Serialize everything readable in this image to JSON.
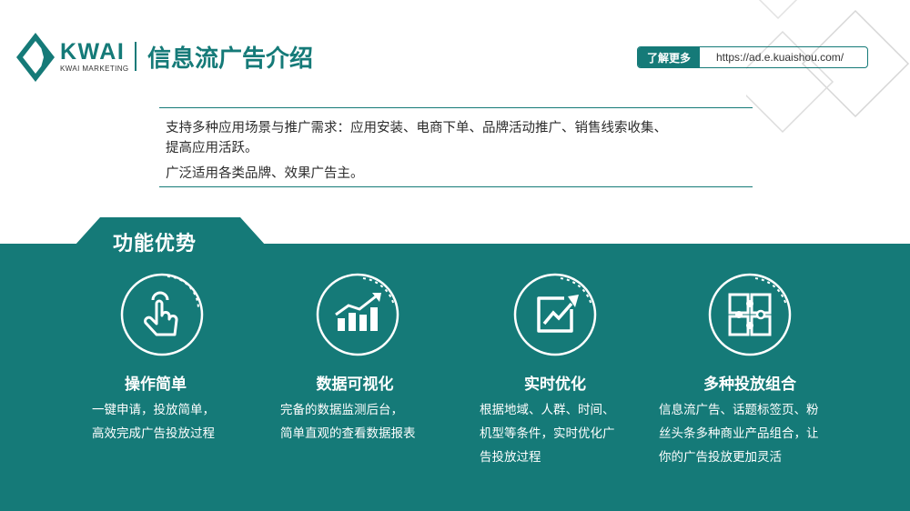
{
  "header": {
    "logo_main_k": "KW",
    "logo_main_ai": "AI",
    "logo_sub": "KWAI MARKETING",
    "title": "信息流广告介绍",
    "learn_more_label": "了解更多",
    "learn_more_url": "https://ad.e.kuaishou.com/"
  },
  "intro": {
    "line1": "支持多种应用场景与推广需求：应用安装、电商下单、品牌活动推广、销售线索收集、",
    "line2": "提高应用活跃。",
    "line3": "广泛适用各类品牌、效果广告主。"
  },
  "section": {
    "title": "功能优势"
  },
  "features": [
    {
      "title": "操作简单",
      "icon": "touch-hand-icon",
      "desc": [
        "一键申请，投放简单，",
        "高效完成广告投放过程"
      ]
    },
    {
      "title": "数据可视化",
      "icon": "bar-chart-trend-icon",
      "desc": [
        "完备的数据监测后台，",
        "简单直观的查看数据报表"
      ]
    },
    {
      "title": "实时优化",
      "icon": "trend-arrow-icon",
      "desc": [
        "根据地域、人群、时间、",
        "机型等条件，实时优化广",
        "告投放过程"
      ]
    },
    {
      "title": "多种投放组合",
      "icon": "puzzle-icon",
      "desc": [
        "信息流广告、话题标签页、粉",
        "丝头条多种商业产品组合，让",
        "你的广告投放更加灵活"
      ]
    }
  ],
  "colors": {
    "brand_teal": "#157a78",
    "text_dark": "#2c2c2c",
    "white": "#ffffff"
  }
}
